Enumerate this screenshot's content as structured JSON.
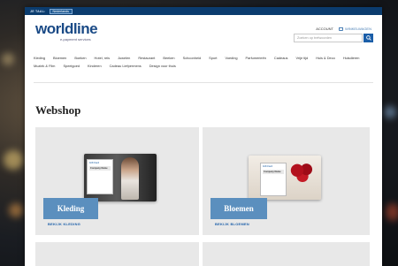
{
  "topbar": {
    "lang_label": "JE TAAL:",
    "lang_value": "Nederlands"
  },
  "header": {
    "logo": "worldline",
    "logo_sub": "e-payment services",
    "account": "ACCOUNT",
    "cart": "WINKELWAGEN",
    "search_placeholder": "Zoeken op trefwoorden"
  },
  "nav": [
    "Kleding",
    "Bloemen",
    "Boeken",
    "Hotel, reis",
    "Juwelen",
    "Restaurant",
    "Beeken",
    "Schoonheid",
    "Sport",
    "Voeding",
    "Parfumerieën",
    "Cadeaus",
    "Vrije tijd",
    "Huis & Deco",
    "Huisdieren",
    "Muziek & Film",
    "Speelgoed",
    "Kinderen",
    "Cadeau Liefpermens",
    "Design voor thuis"
  ],
  "page_title": "Webshop",
  "cards": [
    {
      "label": "Kleding",
      "link": "BEKIJK KLEDING",
      "ticket_title": "Gift Card",
      "ticket_line": "Company Name"
    },
    {
      "label": "Bloemen",
      "link": "BEKIJK BLOEMEN",
      "ticket_title": "Gift Card",
      "ticket_line": "Company Name"
    }
  ],
  "colors": {
    "topbar": "#0b3c6e",
    "accent": "#1b5ea8",
    "label": "#5b8fbe",
    "card": "#e8e8e8"
  }
}
